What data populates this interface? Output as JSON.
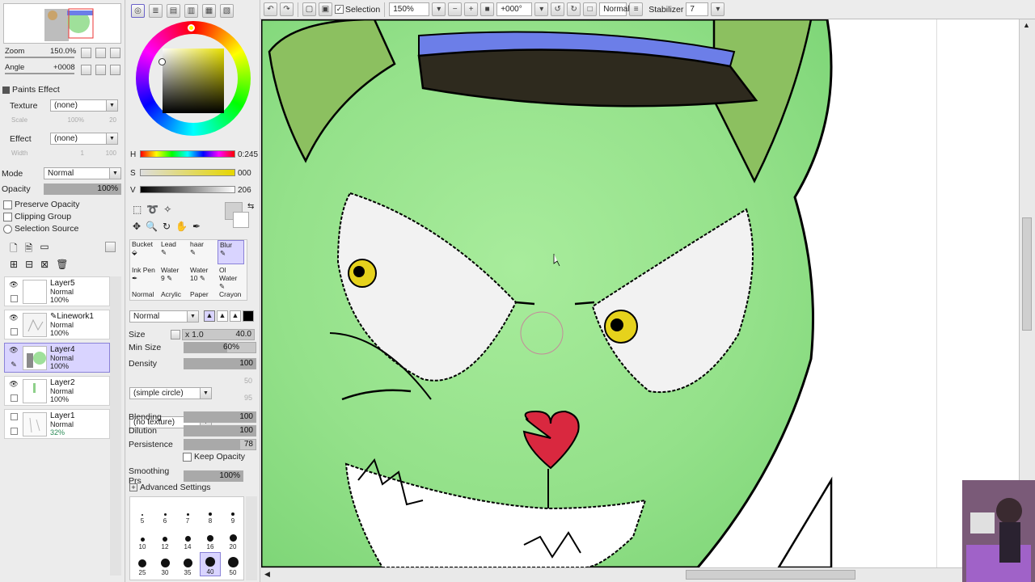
{
  "toolbar": {
    "selection_label": "Selection",
    "zoom_value": "150%",
    "angle_value": "+000°",
    "blend_mode": "Normal",
    "stabilizer_label": "Stabilizer",
    "stabilizer_value": "7"
  },
  "navigator": {
    "zoom_label": "Zoom",
    "zoom_value": "150.0%",
    "angle_label": "Angle",
    "angle_value": "+0008"
  },
  "paints_effect": {
    "title": "Paints Effect",
    "texture_label": "Texture",
    "texture_value": "(none)",
    "scale_label": "Scale",
    "scale_value": "100%",
    "scale_num": "20",
    "effect_label": "Effect",
    "effect_value": "(none)",
    "width_label": "Width",
    "width_value": "1",
    "width_num": "100"
  },
  "layer_props": {
    "mode_label": "Mode",
    "mode_value": "Normal",
    "opacity_label": "Opacity",
    "opacity_value": "100%",
    "opacity_fraction": 1.0,
    "preserve_opacity": "Preserve Opacity",
    "clipping_group": "Clipping Group",
    "selection_source": "Selection Source"
  },
  "layers": [
    {
      "name": "Layer5",
      "mode": "Normal",
      "opacity": "100%",
      "selected": false
    },
    {
      "name": "Linework1",
      "mode": "Normal",
      "opacity": "100%",
      "selected": false
    },
    {
      "name": "Layer4",
      "mode": "Normal",
      "opacity": "100%",
      "selected": true
    },
    {
      "name": "Layer2",
      "mode": "Normal",
      "opacity": "100%",
      "selected": false
    },
    {
      "name": "Layer1",
      "mode": "Normal",
      "opacity": "32%",
      "selected": false
    }
  ],
  "color": {
    "h_label": "H",
    "h_value": "0:245",
    "s_label": "S",
    "s_value": "000",
    "v_label": "V",
    "v_value": "206"
  },
  "tools": {
    "row1": [
      "Bucket",
      "Lead",
      "haar",
      "Blur"
    ],
    "row2": [
      "Ink Pen",
      "Water",
      "Water",
      "Ol Water"
    ],
    "row2_nums": [
      "",
      "9",
      "10",
      ""
    ],
    "row3": [
      "Normal",
      "Acrylic",
      "Paper",
      "Crayon"
    ]
  },
  "brush": {
    "mode_value": "Normal",
    "size_label": "Size",
    "size_mult": "x 1.0",
    "size_value": "40.0",
    "min_size_label": "Min Size",
    "min_size_value": "60%",
    "min_size_fraction": 0.6,
    "density_label": "Density",
    "density_value": "100",
    "shape_value": "(simple circle)",
    "shape_num": "50",
    "texture_value": "(no texture)",
    "texture_num": "95",
    "blending_label": "Blending",
    "blending_value": "100",
    "dilution_label": "Dilution",
    "dilution_value": "100",
    "persistence_label": "Persistence",
    "persistence_value": "78",
    "persistence_fraction": 0.78,
    "keep_opacity": "Keep Opacity",
    "smoothing_label": "Smoothing Prs",
    "smoothing_value": "100%",
    "advanced": "Advanced Settings"
  },
  "brush_sizes": [
    [
      "5",
      "6",
      "7",
      "8",
      "9"
    ],
    [
      "10",
      "12",
      "14",
      "16",
      "20"
    ],
    [
      "25",
      "30",
      "35",
      "40",
      "50"
    ]
  ],
  "colors": {
    "accent": "#d9d4ff",
    "skin": "#97e08a",
    "hat": "#6c7ee8",
    "visor": "#2e2a1e",
    "nose": "#d9283f",
    "iris": "#e6d21c"
  }
}
